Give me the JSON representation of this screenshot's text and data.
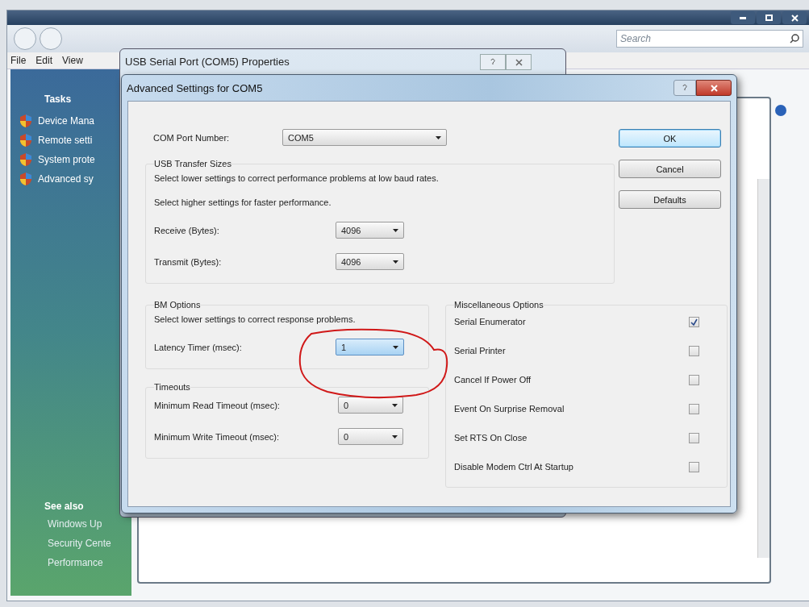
{
  "background_window": {
    "menu": [
      "File",
      "Edit",
      "View"
    ],
    "search": {
      "placeholder": "Search"
    },
    "sidebar": {
      "tasks_title": "Tasks",
      "tasks": [
        "Device Mana",
        "Remote setti",
        "System prote",
        "Advanced sy"
      ],
      "see_also_title": "See also",
      "see_also": [
        "Windows Up",
        "Security Cente",
        "Performance"
      ]
    }
  },
  "properties_dialog": {
    "title": "USB Serial Port (COM5) Properties"
  },
  "advanced_dialog": {
    "title": "Advanced Settings for COM5",
    "com_port": {
      "label": "COM Port Number:",
      "value": "COM5"
    },
    "buttons": [
      {
        "label": "OK",
        "default": true
      },
      {
        "label": "Cancel",
        "default": false
      },
      {
        "label": "Defaults",
        "default": false
      }
    ],
    "usb_transfer": {
      "title": "USB Transfer Sizes",
      "notes": [
        "Select lower settings to correct performance problems at low baud rates.",
        "Select higher settings for faster performance."
      ],
      "fields": [
        {
          "label": "Receive (Bytes):",
          "value": "4096",
          "focused": false
        },
        {
          "label": "Transmit (Bytes):",
          "value": "4096",
          "focused": false
        }
      ]
    },
    "bm_options": {
      "title": "BM Options",
      "note": "Select lower settings to correct response problems.",
      "fields": [
        {
          "label": "Latency Timer (msec):",
          "value": "1",
          "focused": true
        }
      ]
    },
    "timeouts": {
      "title": "Timeouts",
      "fields": [
        {
          "label": "Minimum Read Timeout (msec):",
          "value": "0",
          "focused": false
        },
        {
          "label": "Minimum Write Timeout (msec):",
          "value": "0",
          "focused": false
        }
      ]
    },
    "misc_options": {
      "title": "Miscellaneous Options",
      "options": [
        {
          "label": "Serial Enumerator",
          "checked": true
        },
        {
          "label": "Serial Printer",
          "checked": false
        },
        {
          "label": "Cancel If Power Off",
          "checked": false
        },
        {
          "label": "Event On Surprise Removal",
          "checked": false
        },
        {
          "label": "Set RTS On Close",
          "checked": false
        },
        {
          "label": "Disable Modem Ctrl At Startup",
          "checked": false
        }
      ]
    }
  }
}
